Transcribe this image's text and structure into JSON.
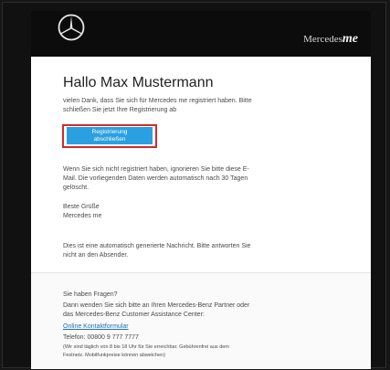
{
  "header": {
    "brand_name": "Mercedes",
    "brand_suffix": "me"
  },
  "email": {
    "greeting": "Hallo Max Mustermann",
    "intro_lines": [
      "vielen Dank, dass Sie sich für Mercedes me registriert haben. Bitte",
      "schließen Sie jetzt Ihre Registrierung ab"
    ],
    "cta_lines": [
      "Registrierung",
      "abschließen"
    ],
    "notice_lines": [
      "Wenn Sie sich nicht registriert haben, ignorieren Sie bitte diese E-",
      "Mail. Die vorliegenden Daten werden automatisch nach 30 Tagen",
      "gelöscht."
    ],
    "signoff_lines": [
      "Beste Grüße",
      "Mercedes me"
    ],
    "auto_lines": [
      "Dies ist eine automatisch generierte Nachricht. Bitte antworten Sie",
      "nicht an den Absender."
    ]
  },
  "footer": {
    "question": "Sie haben Fragen?",
    "contact_lines": [
      "Dann wenden Sie sich bitte an Ihren Mercedes-Benz Partner oder",
      "das Mercedes-Benz Customer Assistance Center:"
    ],
    "contact_link": "Online Kontaktformular",
    "phone": "Telefon: 00800 9 777 7777",
    "hours_lines": [
      "(Wir sind täglich von 8 bis 18 Uhr für Sie erreichbar. Gebührenfrei aus dem",
      "Festnetz. Mobilfunkpreise können abweichen)"
    ]
  }
}
